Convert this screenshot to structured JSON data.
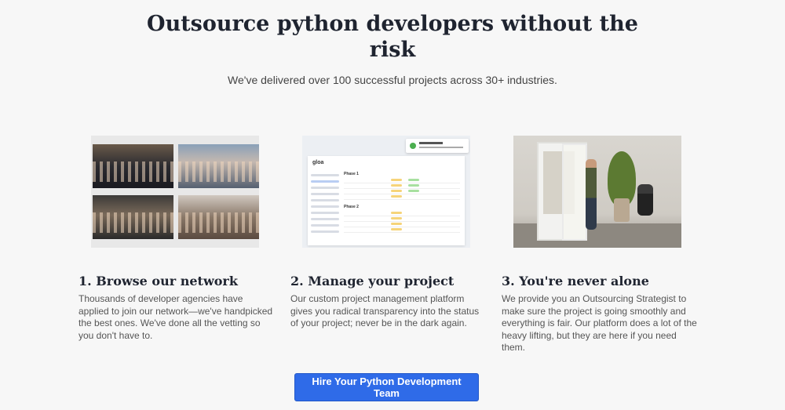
{
  "hero": {
    "title_line1": "Outsource python developers without the",
    "title_line2": "risk",
    "subtitle": "We've delivered over 100 successful projects across 30+ industries."
  },
  "steps": [
    {
      "title": "1. Browse our network",
      "text": "Thousands of developer agencies have applied to join our network—we've handpicked the best ones. We've done all the vetting so you don't have to.",
      "image": "team-photos-collage"
    },
    {
      "title": "2. Manage your project",
      "text": "Our custom project management platform gives you radical transparency into the status of your project; never be in the dark again.",
      "image": "project-dashboard-screenshot"
    },
    {
      "title": "3. You're never alone",
      "text": "We provide you an Outsourcing Strategist to make sure the project is going smoothly and everything is fair. Our platform does a lot of the heavy lifting, but they are here if you need them.",
      "image": "office-phone-booth-photo"
    }
  ],
  "cta": {
    "label": "Hire Your Python Development Team",
    "color": "#2f6be8"
  },
  "dashboard_mock": {
    "logo": "gloa",
    "section1": "Phase 1",
    "section2": "Phase 2"
  }
}
